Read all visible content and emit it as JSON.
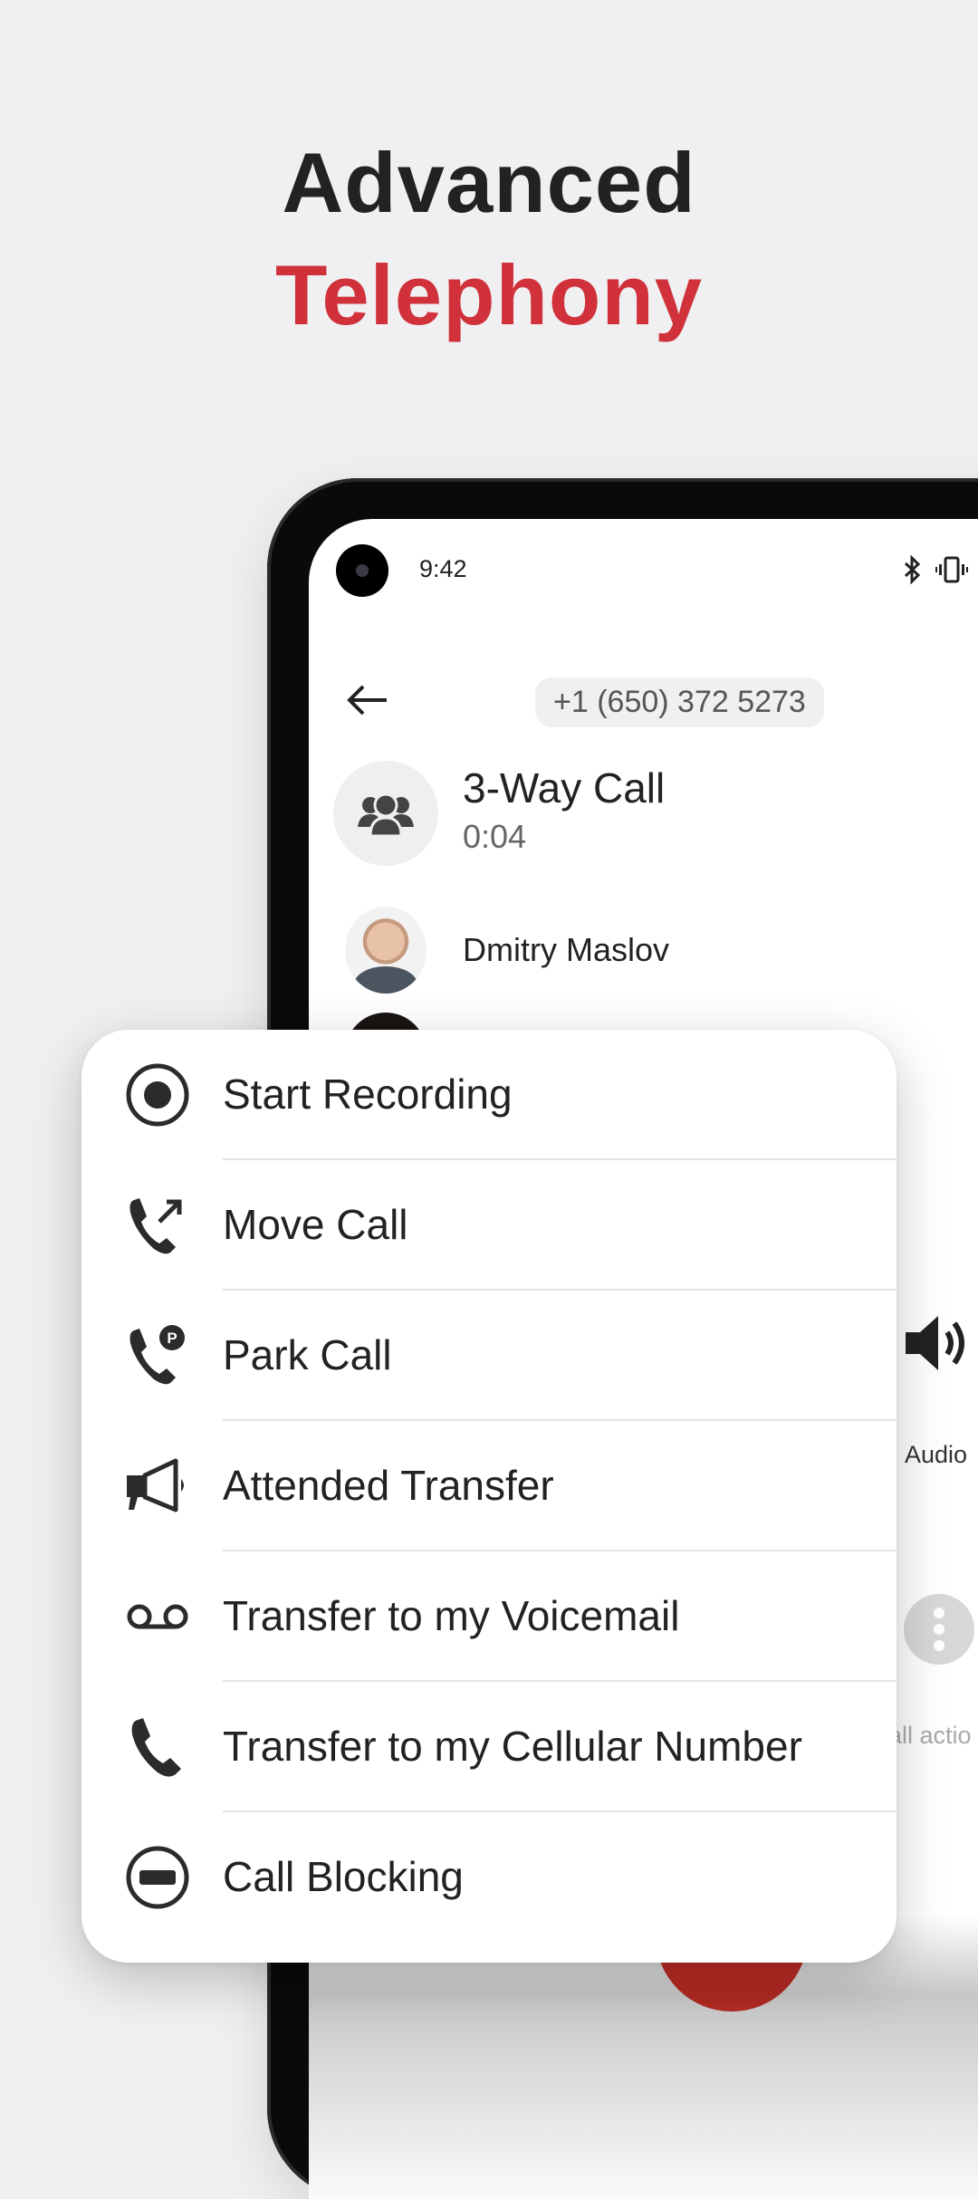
{
  "headline": {
    "line1": "Advanced",
    "line2": "Telephony",
    "line1_color": "#222222",
    "line2_color": "#d0313a"
  },
  "status_bar": {
    "time": "9:42",
    "icons": [
      "bluetooth-icon",
      "vibrate-icon",
      "wifi-icon",
      "cell-signal-icon",
      "battery-icon"
    ]
  },
  "call_header": {
    "back_icon": "arrow-left-icon",
    "phone_number": "+1 (650) 372 5273"
  },
  "conference": {
    "icon": "group-icon",
    "title": "3-Way Call",
    "duration": "0:04"
  },
  "participants": [
    {
      "name": "Dmitry Maslov"
    }
  ],
  "controls": {
    "audio_label": "Audio",
    "more_label": "Call actions",
    "more_label_visible": "all actio",
    "end_call_color": "#e2362c"
  },
  "menu": {
    "items": [
      {
        "label": "Start Recording",
        "icon": "record-icon"
      },
      {
        "label": "Move Call",
        "icon": "move-call-icon"
      },
      {
        "label": "Park Call",
        "icon": "park-call-icon"
      },
      {
        "label": "Attended Transfer",
        "icon": "megaphone-icon"
      },
      {
        "label": "Transfer to my Voicemail",
        "icon": "voicemail-icon"
      },
      {
        "label": "Transfer to my Cellular Number",
        "icon": "phone-icon"
      },
      {
        "label": "Call Blocking",
        "icon": "block-icon"
      }
    ]
  }
}
